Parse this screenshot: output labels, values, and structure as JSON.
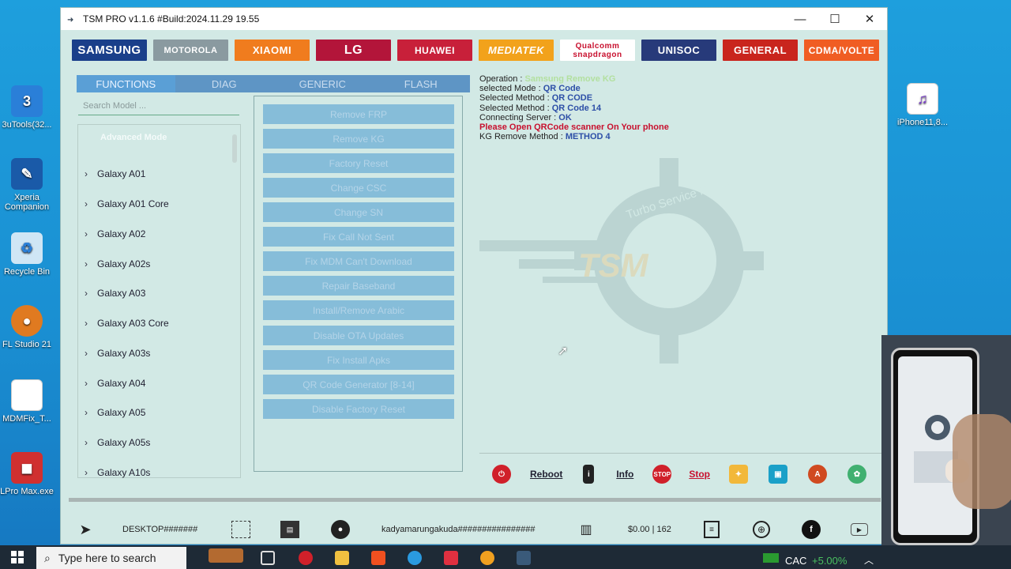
{
  "window": {
    "title": "TSM PRO v1.1.6 #Build:2024.11.29 19.55"
  },
  "brands": [
    {
      "label": "SAMSUNG",
      "color": "#1a3f8a"
    },
    {
      "label": "MOTOROLA",
      "color": "#8a9aa0"
    },
    {
      "label": "XIAOMI",
      "color": "#f07c1e"
    },
    {
      "label": "LG",
      "color": "#b3153a"
    },
    {
      "label": "HUAWEI",
      "color": "#c8203a"
    },
    {
      "label": "MEDIATEK",
      "color": "#f2a21b"
    },
    {
      "label": "Qualcomm snapdragon",
      "color": "#ffffff"
    },
    {
      "label": "UNISOC",
      "color": "#273a7a"
    },
    {
      "label": "GENERAL",
      "color": "#c9251d"
    },
    {
      "label": "CDMA/VOLTE",
      "color": "#f05d23"
    }
  ],
  "tabs": [
    {
      "label": "FUNCTIONS"
    },
    {
      "label": "DIAG"
    },
    {
      "label": "GENERIC"
    },
    {
      "label": "FLASH"
    }
  ],
  "search": {
    "placeholder": "Search Model ..."
  },
  "models": {
    "header": "Advanced Mode",
    "items": [
      "Galaxy A01",
      "Galaxy A01 Core",
      "Galaxy A02",
      "Galaxy A02s",
      "Galaxy A03",
      "Galaxy A03 Core",
      "Galaxy A03s",
      "Galaxy A04",
      "Galaxy A05",
      "Galaxy A05s",
      "Galaxy A10s"
    ]
  },
  "functions": [
    "Remove FRP",
    "Remove KG",
    "Factory Reset",
    "Change CSC",
    "Change SN",
    "Fix Call Not Sent",
    "Fix MDM Can't Download",
    "Repair Baseband",
    "Install/Remove Arabic",
    "Disable OTA Updates",
    "Fix Install Apks",
    "QR Code Generator [8-14]",
    "Disable Factory Reset"
  ],
  "log": {
    "operation_label": "Operation : ",
    "operation_value": "Samsung Remove KG",
    "mode_label": "selected Mode : ",
    "mode_value": "QR Code",
    "method1_label": "Selected Method : ",
    "method1_value": "QR CODE",
    "method2_label": "Selected Method : ",
    "method2_value": "QR Code 14",
    "server_label": "Connecting Server : ",
    "server_value": "OK",
    "warning": "Please Open QRCode scanner On Your phone",
    "kg_label": "KG Remove Method : ",
    "kg_value": "METHOD 4"
  },
  "watermark": {
    "text": "TSM",
    "ring_text": "Turbo Service Mobile"
  },
  "actions": {
    "reboot": "Reboot",
    "info": "Info",
    "stop": "Stop",
    "stop_sign": "STOP"
  },
  "status": {
    "computer": "DESKTOP#######",
    "user": "kadyamarungakuda################",
    "balance": "$0.00 | 162"
  },
  "desktop": [
    {
      "label": "3uTools(32...",
      "color": "#2a7fd8"
    },
    {
      "label": "Xperia Companion",
      "color": "#1a5aa8"
    },
    {
      "label": "Recycle Bin",
      "color": "#5aa0d8"
    },
    {
      "label": "FL Studio 21",
      "color": "#e07a20"
    },
    {
      "label": "MDMFix_T...",
      "color": "#ffffff"
    },
    {
      "label": "LPro Max.exe",
      "color": "#d03030"
    },
    {
      "label": "iPhone11,8...",
      "color": "#ffffff"
    }
  ],
  "taskbar": {
    "search_placeholder": "Type here to search",
    "ticker": "CAC",
    "change": "+5.00%"
  }
}
